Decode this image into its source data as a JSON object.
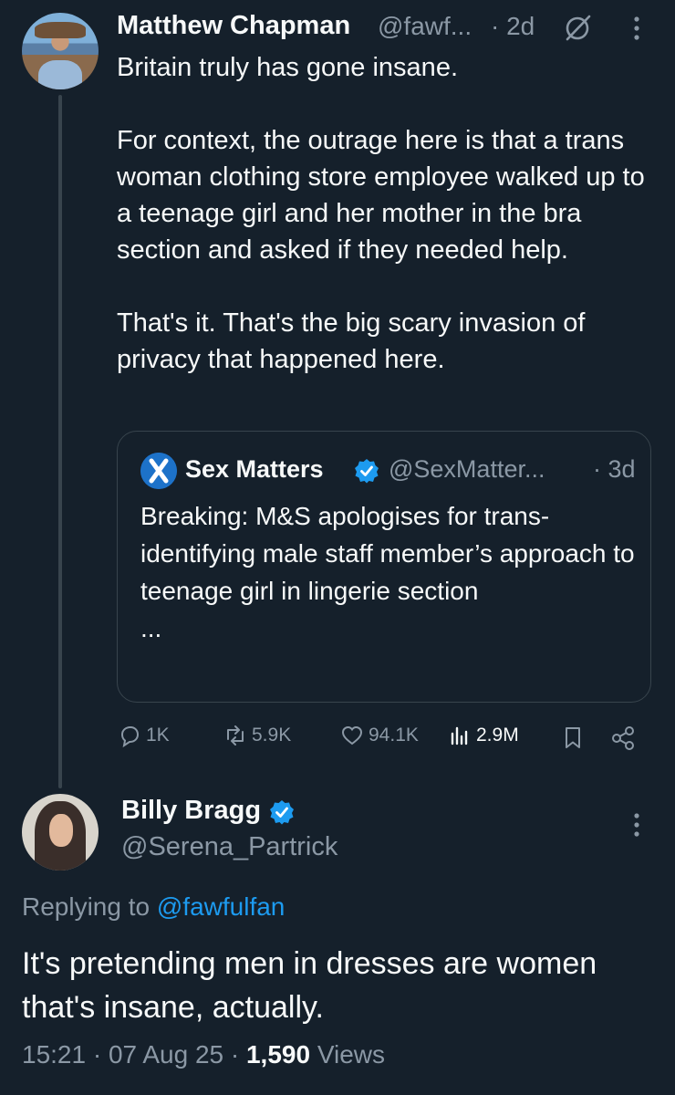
{
  "tweet": {
    "author_name": "Matthew Chapman",
    "author_handle": "@fawf...",
    "time": "· 2d",
    "text": "Britain truly has gone insane.\n\nFor context, the outrage here is that a trans woman clothing store employee walked up to a teenage girl and her mother in the bra section and asked if they needed help.\n\nThat's it. That's the big scary invasion of privacy that happened here.",
    "quote": {
      "author_name": "Sex Matters",
      "author_handle": "@SexMatter...",
      "time": "· 3d",
      "text": "Breaking: M&S apologises for trans-identifying male staff member’s approach to teenage girl in lingerie section\n..."
    },
    "actions": {
      "replies": "1K",
      "reposts": "5.9K",
      "likes": "94.1K",
      "views": "2.9M"
    }
  },
  "reply": {
    "author_name": "Billy Bragg",
    "author_handle": "@Serena_Partrick",
    "replying_prefix": "Replying to",
    "replying_to": "@fawfulfan",
    "text": "It's pretending men in dresses are women that's insane, actually.",
    "time": "15:21",
    "date": "07 Aug 25",
    "views_count": "1,590",
    "views_label": "Views"
  },
  "colors": {
    "background": "#15202b",
    "text": "#f7f9f9",
    "muted": "#8b98a5",
    "accent": "#1d9bf0",
    "border": "#38444d"
  },
  "icons": [
    "grok-icon",
    "more-icon",
    "verified-badge-icon",
    "reply-icon",
    "repost-icon",
    "like-icon",
    "views-icon",
    "bookmark-icon",
    "share-icon"
  ]
}
